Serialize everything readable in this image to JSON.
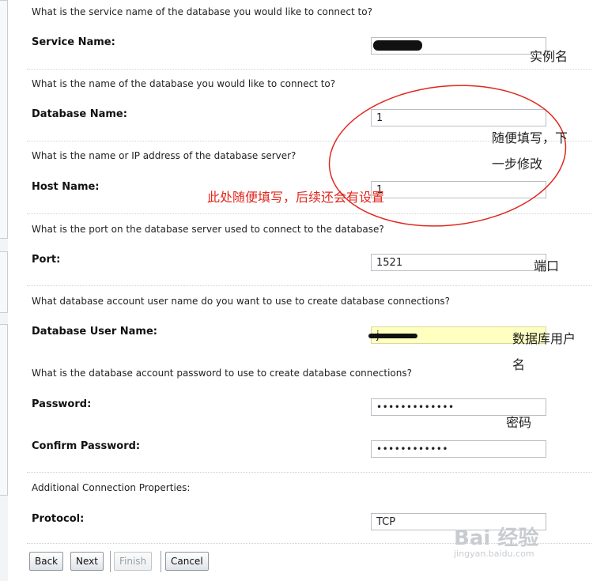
{
  "questions": {
    "service": "What is the service name of the database you would like to connect to?",
    "database": "What is the name of the database you would like to connect to?",
    "host": "What is the name or IP address of the database server?",
    "port": "What is the port on the database server used to connect to the database?",
    "user": "What database account user name do you want to use to create database connections?",
    "password": "What is the database account password to use to create database connections?",
    "additional": "Additional Connection Properties:"
  },
  "labels": {
    "service": "Service Name:",
    "database": "Database Name:",
    "host": "Host Name:",
    "port": "Port:",
    "user": "Database User Name:",
    "password": "Password:",
    "confirm": "Confirm Password:",
    "protocol": "Protocol:"
  },
  "fields": {
    "service": "",
    "database": "1",
    "host": "1",
    "port": "1521",
    "user": "j",
    "password": "•••••••••••••",
    "confirm": "••••••••••••",
    "protocol": "TCP"
  },
  "annotations": {
    "instance_name": "实例名",
    "fill_anything_line1": "随便填写，下",
    "fill_anything_line2": "一步修改",
    "host_note": "此处随便填写，后续还会有设置",
    "port_note": "端口",
    "user_note_line1": "数据库用户",
    "user_note_line2": "名",
    "password_note": "密码"
  },
  "buttons": {
    "back": "Back",
    "next": "Next",
    "finish": "Finish",
    "cancel": "Cancel"
  },
  "watermark": {
    "logo": "Bai 经验",
    "url": "jingyan.baidu.com"
  },
  "colors": {
    "annotation_red": "#e0281e",
    "highlight_yellow": "#ffffc0"
  }
}
